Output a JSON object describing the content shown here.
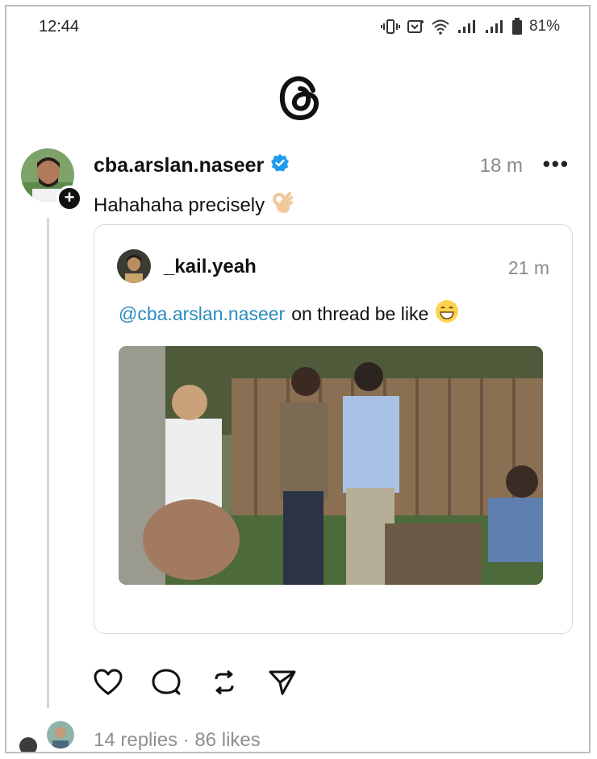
{
  "status_bar": {
    "time": "12:44",
    "battery": "81%"
  },
  "post": {
    "username": "cba.arslan.naseer",
    "time_ago": "18 m",
    "more": "•••",
    "text": "Hahahaha precisely",
    "text_emoji": "ok-hand",
    "quote": {
      "username": "_kail.yeah",
      "time_ago": "21 m",
      "mention": "@cba.arslan.naseer",
      "text": "on thread be like",
      "text_emoji": "grinning-face"
    },
    "stats": "14 replies · 86 likes"
  },
  "colors": {
    "mention": "#2a8bbf",
    "verified": "#1d9bf0",
    "muted": "#8a8a8a"
  },
  "icons": [
    "vibrate-icon",
    "nfc-icon",
    "wifi-icon",
    "signal-icon",
    "battery-icon",
    "threads-logo-icon",
    "verified-icon",
    "heart-icon",
    "comment-icon",
    "repost-icon",
    "share-icon"
  ]
}
